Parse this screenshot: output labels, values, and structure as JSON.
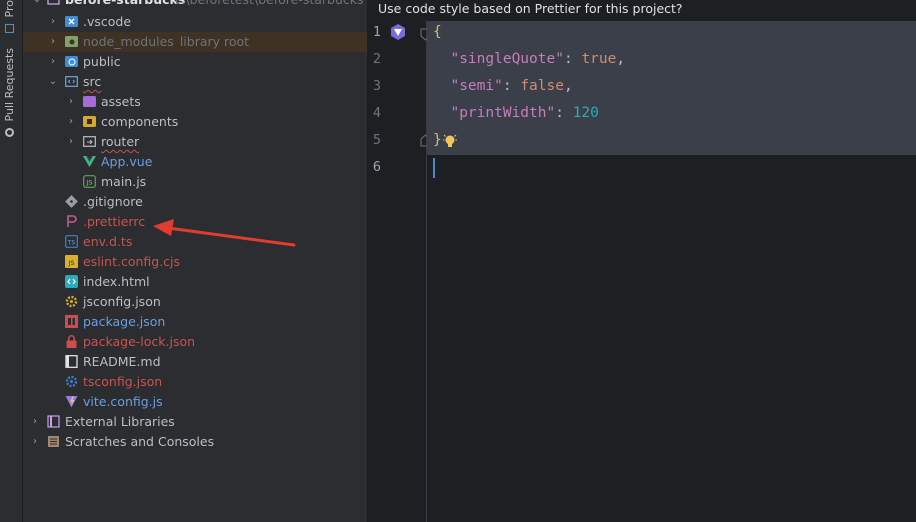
{
  "side_strip": {
    "tabs": [
      {
        "label": "Pro"
      },
      {
        "label": "Pull Requests"
      }
    ]
  },
  "project_tree": {
    "root": {
      "label": "before-starbucks",
      "path": "F:\\beforetest\\before-starbucks"
    },
    "items": [
      {
        "label": ".vscode"
      },
      {
        "label": "node_modules",
        "note": "library root"
      },
      {
        "label": "public"
      },
      {
        "label": "src"
      },
      {
        "label": "assets"
      },
      {
        "label": "components"
      },
      {
        "label": "router"
      },
      {
        "label": "App.vue"
      },
      {
        "label": "main.js"
      },
      {
        "label": ".gitignore"
      },
      {
        "label": ".prettierrc"
      },
      {
        "label": "env.d.ts"
      },
      {
        "label": "eslint.config.cjs"
      },
      {
        "label": "index.html"
      },
      {
        "label": "jsconfig.json"
      },
      {
        "label": "package.json"
      },
      {
        "label": "package-lock.json"
      },
      {
        "label": "README.md"
      },
      {
        "label": "tsconfig.json"
      },
      {
        "label": "vite.config.js"
      },
      {
        "label": "External Libraries"
      },
      {
        "label": "Scratches and Consoles"
      }
    ]
  },
  "editor": {
    "banner": "Use code style based on Prettier for this project?",
    "line_numbers": [
      "1",
      "2",
      "3",
      "4",
      "5",
      "6"
    ],
    "code": {
      "open_brace": "{",
      "close_brace": "}",
      "entries": [
        {
          "key": "\"singleQuote\"",
          "value": "true",
          "suffix": ","
        },
        {
          "key": "\"semi\"",
          "value": "false",
          "suffix": ","
        },
        {
          "key": "\"printWidth\"",
          "value": "120",
          "suffix": ""
        }
      ]
    }
  },
  "annotation": {
    "color": "#e03c31"
  }
}
